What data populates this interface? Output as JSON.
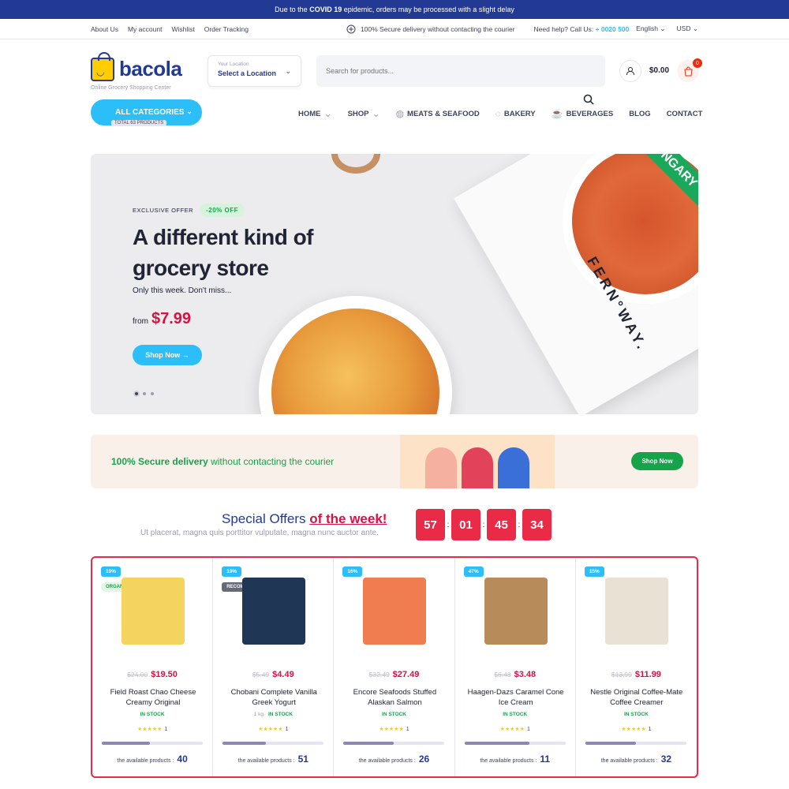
{
  "topbar": {
    "text_pre": "Due to the",
    "text_bold": "COVID 19",
    "text_post": "epidemic, orders may be processed with a slight delay"
  },
  "util": {
    "links": [
      "About Us",
      "My account",
      "Wishlist",
      "Order Tracking"
    ],
    "secure": "100% Secure delivery without contacting the courier",
    "help": "Need help? Call Us:",
    "phone": "+ 0020 500",
    "lang": "English",
    "currency": "USD"
  },
  "header": {
    "logo": "bacola",
    "tagline": "Online Grocery Shopping Center",
    "location_label": "Your Location",
    "location_value": "Select a Location",
    "search_placeholder": "Search for products...",
    "cart_total": "$0.00",
    "cart_count": "0"
  },
  "nav": {
    "all_categories": "ALL CATEGORIES",
    "total_products": "TOTAL 63 PRODUCTS",
    "items": [
      "HOME",
      "SHOP",
      "MEATS & SEAFOOD",
      "BAKERY",
      "BEVERAGES",
      "BLOG",
      "CONTACT"
    ]
  },
  "hero": {
    "offer_label": "EXCLUSIVE OFFER",
    "offer_pct": "-20% OFF",
    "title": "A different kind of grocery store",
    "subtitle": "Only this week. Don't miss...",
    "from": "from",
    "price": "$7.99",
    "button": "Shop Now",
    "box_text": "FERN°WAY.",
    "band_text": "NGARY"
  },
  "banner": {
    "text_bold": "100% Secure delivery",
    "text_rest": "without contacting the courier",
    "button": "Shop Now"
  },
  "special": {
    "title": "Special Offers",
    "title_red": "of the week!",
    "desc": "Ut placerat, magna quis porttitor vulputate, magna nunc auctor ante.",
    "countdown": [
      "57",
      "01",
      "45",
      "34"
    ]
  },
  "products": [
    {
      "discount": "19%",
      "tag": "ORGANIC",
      "old": "$24.00",
      "new": "$19.50",
      "name": "Field Roast Chao Cheese Creamy Original",
      "unit": "",
      "stock": "IN STOCK",
      "rating": "1",
      "available_label": "the available products :",
      "available": "40",
      "sold_fraction": 0.48,
      "color": "#f4d35e"
    },
    {
      "discount": "19%",
      "tag": "RECOMMENDED",
      "old": "$5.49",
      "new": "$4.49",
      "name": "Chobani Complete Vanilla Greek Yogurt",
      "unit": "1 kg",
      "stock": "IN STOCK",
      "rating": "1",
      "available_label": "the available products :",
      "available": "51",
      "sold_fraction": 0.43,
      "color": "#1f3654"
    },
    {
      "discount": "16%",
      "tag": "",
      "old": "$32.49",
      "new": "$27.49",
      "name": "Encore Seafoods Stuffed Alaskan Salmon",
      "unit": "",
      "stock": "IN STOCK",
      "rating": "1",
      "available_label": "the available products :",
      "available": "26",
      "sold_fraction": 0.5,
      "color": "#ef7d4f"
    },
    {
      "discount": "47%",
      "tag": "",
      "old": "$6.48",
      "new": "$3.48",
      "name": "Haagen-Dazs Caramel Cone Ice Cream",
      "unit": "",
      "stock": "IN STOCK",
      "rating": "1",
      "available_label": "the available products :",
      "available": "11",
      "sold_fraction": 0.64,
      "color": "#b88b5a"
    },
    {
      "discount": "15%",
      "tag": "",
      "old": "$13.99",
      "new": "$11.99",
      "name": "Nestle Original Coffee-Mate Coffee Creamer",
      "unit": "",
      "stock": "IN STOCK",
      "rating": "1",
      "available_label": "the available products :",
      "available": "32",
      "sold_fraction": 0.5,
      "color": "#e9e2d4"
    }
  ]
}
